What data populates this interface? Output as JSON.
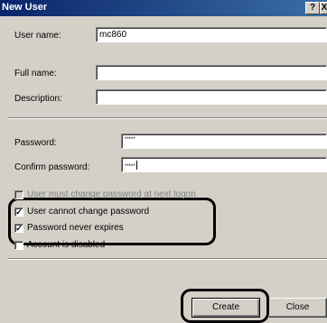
{
  "window": {
    "title": "New User",
    "help_label": "?",
    "close_label": "X",
    "title_bar_color": "#0a246a",
    "dialog_color": "#d4d0c8"
  },
  "fields": {
    "username_label": "User name:",
    "username_value": "mc860",
    "fullname_label": "Full name:",
    "fullname_value": "",
    "description_label": "Description:",
    "description_value": "",
    "password_label": "Password:",
    "password_value": "*****",
    "confirm_label": "Confirm password:",
    "confirm_value": "*****"
  },
  "options": {
    "must_change_label": "User must change password at next logon",
    "must_change_checked": false,
    "must_change_enabled": false,
    "cannot_change_label": "User cannot change password",
    "cannot_change_checked": true,
    "never_expires_label": "Password never expires",
    "never_expires_checked": true,
    "disabled_label": "Account is disabled",
    "disabled_checked": false
  },
  "buttons": {
    "create_label": "Create",
    "close_label": "Close"
  },
  "annotation": {
    "highlight_color": "#000000"
  }
}
